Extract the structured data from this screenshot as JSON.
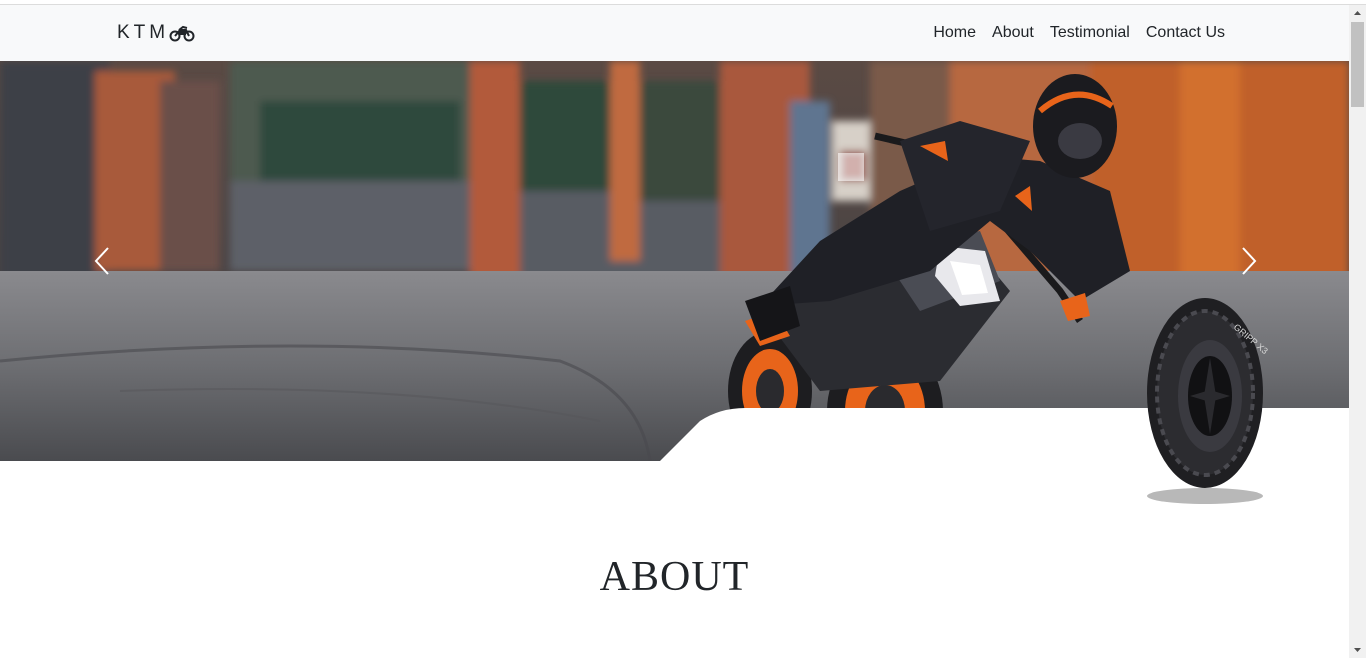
{
  "brand": {
    "name": "KTM",
    "icon": "motorcycle-icon"
  },
  "nav": {
    "items": [
      {
        "label": "Home"
      },
      {
        "label": "About"
      },
      {
        "label": "Testimonial"
      },
      {
        "label": "Contact Us"
      }
    ]
  },
  "carousel": {
    "prev_icon": "chevron-left-icon",
    "next_icon": "chevron-right-icon",
    "slide_description": "motorcycle-rider-cornering",
    "accent_color": "#e8641a"
  },
  "tyre": {
    "brand_text": "GRIPP X3"
  },
  "about": {
    "title": "ABOUT"
  }
}
